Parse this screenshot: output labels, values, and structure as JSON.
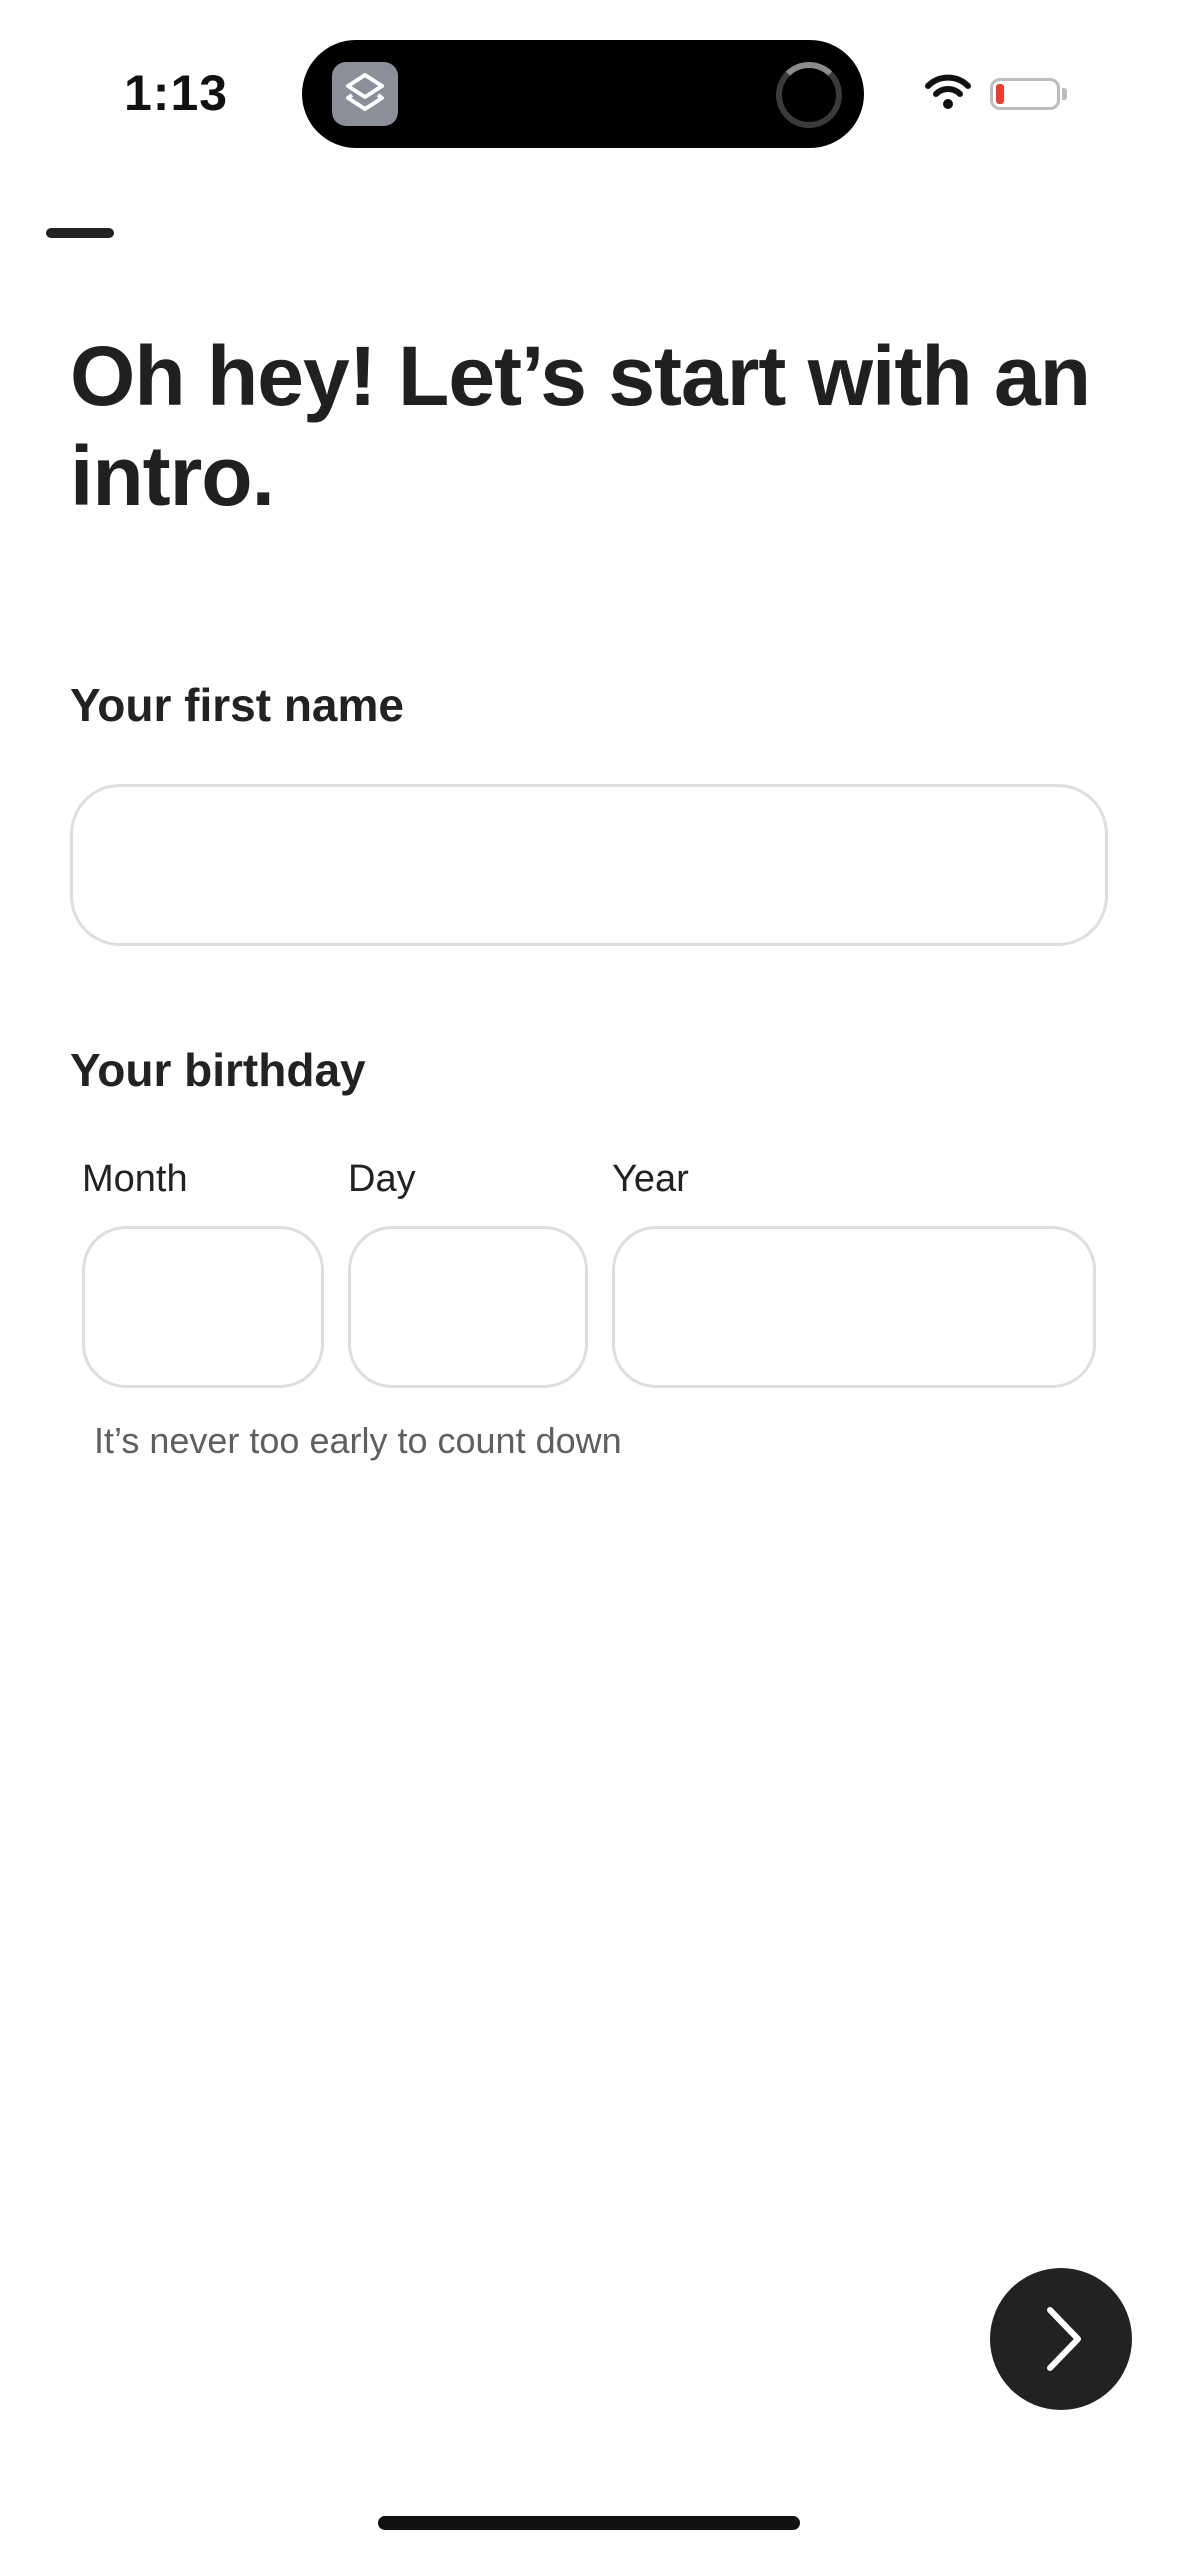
{
  "status_bar": {
    "time": "1:13",
    "battery_color": "#ee3b2f",
    "icons": [
      "shortcuts-app-icon",
      "loading-spinner-icon",
      "wifi-icon",
      "battery-low-icon"
    ]
  },
  "page": {
    "title": "Oh hey! Let’s start with an intro."
  },
  "first_name": {
    "label": "Your first name",
    "value": "",
    "placeholder": ""
  },
  "birthday": {
    "label": "Your birthday",
    "month_label": "Month",
    "day_label": "Day",
    "year_label": "Year",
    "month_value": "",
    "day_value": "",
    "year_value": "",
    "helper": "It’s never too early to count down"
  },
  "next_button": {
    "icon": "chevron-right-icon",
    "background": "#222222"
  }
}
